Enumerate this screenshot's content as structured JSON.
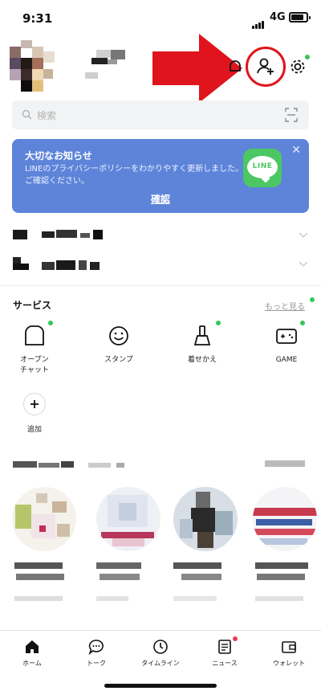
{
  "status_bar": {
    "time": "9:31",
    "network": "4G"
  },
  "search": {
    "placeholder": "検索"
  },
  "banner": {
    "title": "大切なお知らせ",
    "description": "LINEのプライバシーポリシーをわかりやすく更新しました。ご確認ください。",
    "confirm_label": "確認",
    "close_label": "✕",
    "logo_text": "LINE"
  },
  "services": {
    "title": "サービス",
    "more_label": "もっと見る",
    "items": [
      {
        "label": "オープン\nチャット",
        "icon": "open-chat-icon",
        "new": true
      },
      {
        "label": "スタンプ",
        "icon": "sticker-smile-icon",
        "new": false
      },
      {
        "label": "着せかえ",
        "icon": "theme-brush-icon",
        "new": true
      },
      {
        "label": "GAME",
        "icon": "game-controller-icon",
        "new": true
      }
    ],
    "add_label": "追加"
  },
  "tabs": [
    {
      "label": "ホーム",
      "icon": "home-icon",
      "active": true
    },
    {
      "label": "トーク",
      "icon": "chat-bubble-icon",
      "active": false
    },
    {
      "label": "タイムライン",
      "icon": "clock-icon",
      "active": false
    },
    {
      "label": "ニュース",
      "icon": "news-icon",
      "active": false,
      "badge": true
    },
    {
      "label": "ウォレット",
      "icon": "wallet-icon",
      "active": false
    }
  ],
  "colors": {
    "banner_bg": "#5d84d9",
    "line_green": "#4cc764",
    "notification_dot": "#34c759",
    "annotation_red": "#e0141c"
  }
}
